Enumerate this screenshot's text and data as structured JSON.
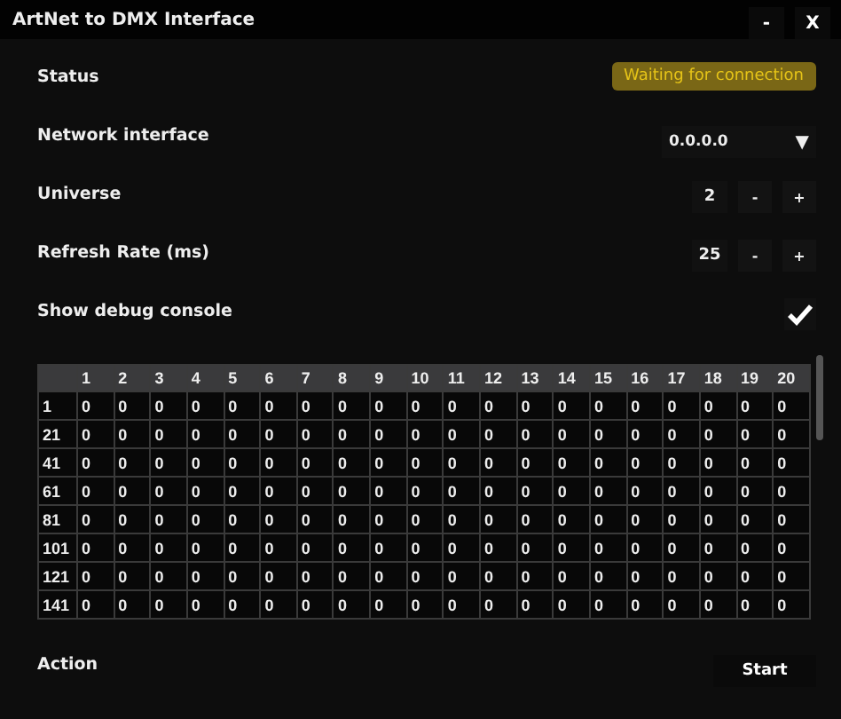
{
  "window": {
    "title": "ArtNet to DMX Interface",
    "buttons": [
      "-",
      "X"
    ]
  },
  "settings": [
    {
      "kind": "status",
      "label": "Status",
      "value": "Waiting for connection"
    },
    {
      "kind": "dropdown",
      "label": "Network interface",
      "value": "0.0.0.0",
      "caret": "▼"
    },
    {
      "kind": "stepper",
      "label": "Universe",
      "value": "2",
      "minus": "-",
      "plus": "+"
    },
    {
      "kind": "stepper",
      "label": "Refresh Rate (ms)",
      "value": "25",
      "minus": "-",
      "plus": "+"
    },
    {
      "kind": "checkbox",
      "label": "Show debug console",
      "checked": true
    }
  ],
  "table": {
    "columns": [
      "1",
      "2",
      "3",
      "4",
      "5",
      "6",
      "7",
      "8",
      "9",
      "10",
      "11",
      "12",
      "13",
      "14",
      "15",
      "16",
      "17",
      "18",
      "19",
      "20"
    ],
    "rows": [
      {
        "label": "1",
        "values": [
          "0",
          "0",
          "0",
          "0",
          "0",
          "0",
          "0",
          "0",
          "0",
          "0",
          "0",
          "0",
          "0",
          "0",
          "0",
          "0",
          "0",
          "0",
          "0",
          "0"
        ]
      },
      {
        "label": "21",
        "values": [
          "0",
          "0",
          "0",
          "0",
          "0",
          "0",
          "0",
          "0",
          "0",
          "0",
          "0",
          "0",
          "0",
          "0",
          "0",
          "0",
          "0",
          "0",
          "0",
          "0"
        ]
      },
      {
        "label": "41",
        "values": [
          "0",
          "0",
          "0",
          "0",
          "0",
          "0",
          "0",
          "0",
          "0",
          "0",
          "0",
          "0",
          "0",
          "0",
          "0",
          "0",
          "0",
          "0",
          "0",
          "0"
        ]
      },
      {
        "label": "61",
        "values": [
          "0",
          "0",
          "0",
          "0",
          "0",
          "0",
          "0",
          "0",
          "0",
          "0",
          "0",
          "0",
          "0",
          "0",
          "0",
          "0",
          "0",
          "0",
          "0",
          "0"
        ]
      },
      {
        "label": "81",
        "values": [
          "0",
          "0",
          "0",
          "0",
          "0",
          "0",
          "0",
          "0",
          "0",
          "0",
          "0",
          "0",
          "0",
          "0",
          "0",
          "0",
          "0",
          "0",
          "0",
          "0"
        ]
      },
      {
        "label": "101",
        "values": [
          "0",
          "0",
          "0",
          "0",
          "0",
          "0",
          "0",
          "0",
          "0",
          "0",
          "0",
          "0",
          "0",
          "0",
          "0",
          "0",
          "0",
          "0",
          "0",
          "0"
        ]
      },
      {
        "label": "121",
        "values": [
          "0",
          "0",
          "0",
          "0",
          "0",
          "0",
          "0",
          "0",
          "0",
          "0",
          "0",
          "0",
          "0",
          "0",
          "0",
          "0",
          "0",
          "0",
          "0",
          "0"
        ]
      },
      {
        "label": "141",
        "values": [
          "0",
          "0",
          "0",
          "0",
          "0",
          "0",
          "0",
          "0",
          "0",
          "0",
          "0",
          "0",
          "0",
          "0",
          "0",
          "0",
          "0",
          "0",
          "0",
          "0"
        ]
      }
    ]
  },
  "action": {
    "label": "Action",
    "button": "Start"
  }
}
